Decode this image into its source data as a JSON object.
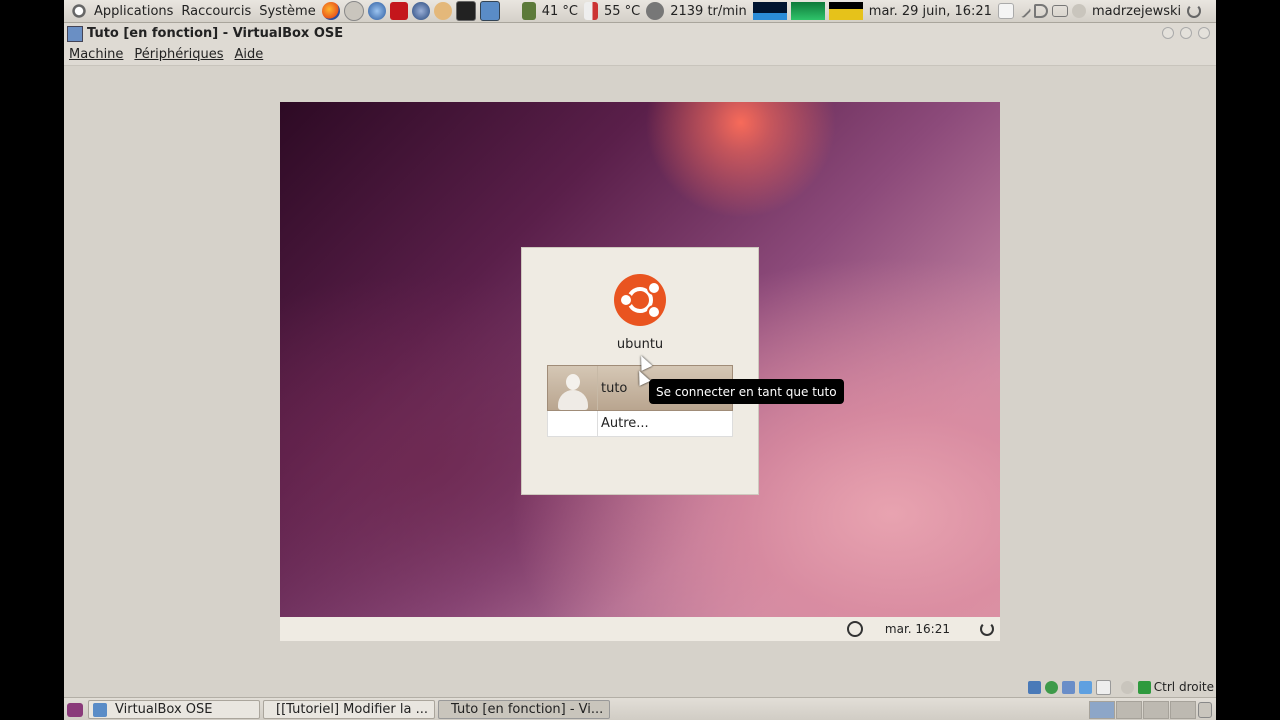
{
  "top_panel": {
    "menu_applications": "Applications",
    "menu_places": "Raccourcis",
    "menu_system": "Système",
    "temp1": "41 °C",
    "temp2": "55 °C",
    "fan_speed": "2139 tr/min",
    "clock": "mar. 29 juin, 16:21",
    "username": "madrzejewski"
  },
  "window": {
    "title": "Tuto [en fonction] - VirtualBox OSE",
    "menus": [
      "Machine",
      "Périphériques",
      "Aide"
    ]
  },
  "guest": {
    "hostname": "ubuntu",
    "users": [
      {
        "name": "tuto"
      }
    ],
    "other_label": "Autre...",
    "tooltip": "Se connecter en tant que tuto",
    "bar_time": "mar. 16:21"
  },
  "vbox_status": {
    "host_key": "Ctrl droite"
  },
  "taskbar": {
    "tasks": [
      {
        "label": "VirtualBox OSE"
      },
      {
        "label": "[[Tutoriel] Modifier la ..."
      },
      {
        "label": "Tuto [en fonction] - Vi..."
      }
    ]
  },
  "colors": {
    "ubuntu_orange": "#e95420",
    "panel_bg": "#d6d2ca"
  }
}
